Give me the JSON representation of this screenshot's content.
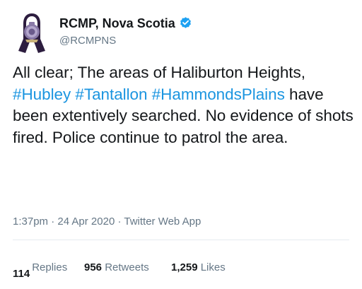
{
  "author": {
    "display_name": "RCMP, Nova Scotia",
    "handle": "@RCMPNS",
    "verified_icon": "verified-badge-icon",
    "avatar_icon": "rcmp-badge-ribbon-avatar"
  },
  "tweet": {
    "text_before": "All clear; The areas of Haliburton Heights, ",
    "hashtag_1": "#Hubley",
    "space_1": " ",
    "hashtag_2": "#Tantallon",
    "space_2": " ",
    "hashtag_3": "#HammondsPlains",
    "text_after": " have been extentively searched. No evidence of shots fired. Police continue to patrol the area."
  },
  "meta": {
    "time": "1:37pm",
    "sep_1": " · ",
    "date": "24 Apr 2020",
    "sep_2": " · ",
    "client": "Twitter Web App"
  },
  "stats": {
    "replies_count": "114",
    "replies_label": "Replies",
    "retweets_count": "956",
    "retweets_label": "Retweets",
    "likes_count": "1,259",
    "likes_label": "Likes"
  },
  "colors": {
    "hashtag": "#1b95e0",
    "verified": "#1da1f2",
    "muted_text": "#657786",
    "primary_text": "#14171a",
    "ribbon": "#2d1d3f"
  }
}
